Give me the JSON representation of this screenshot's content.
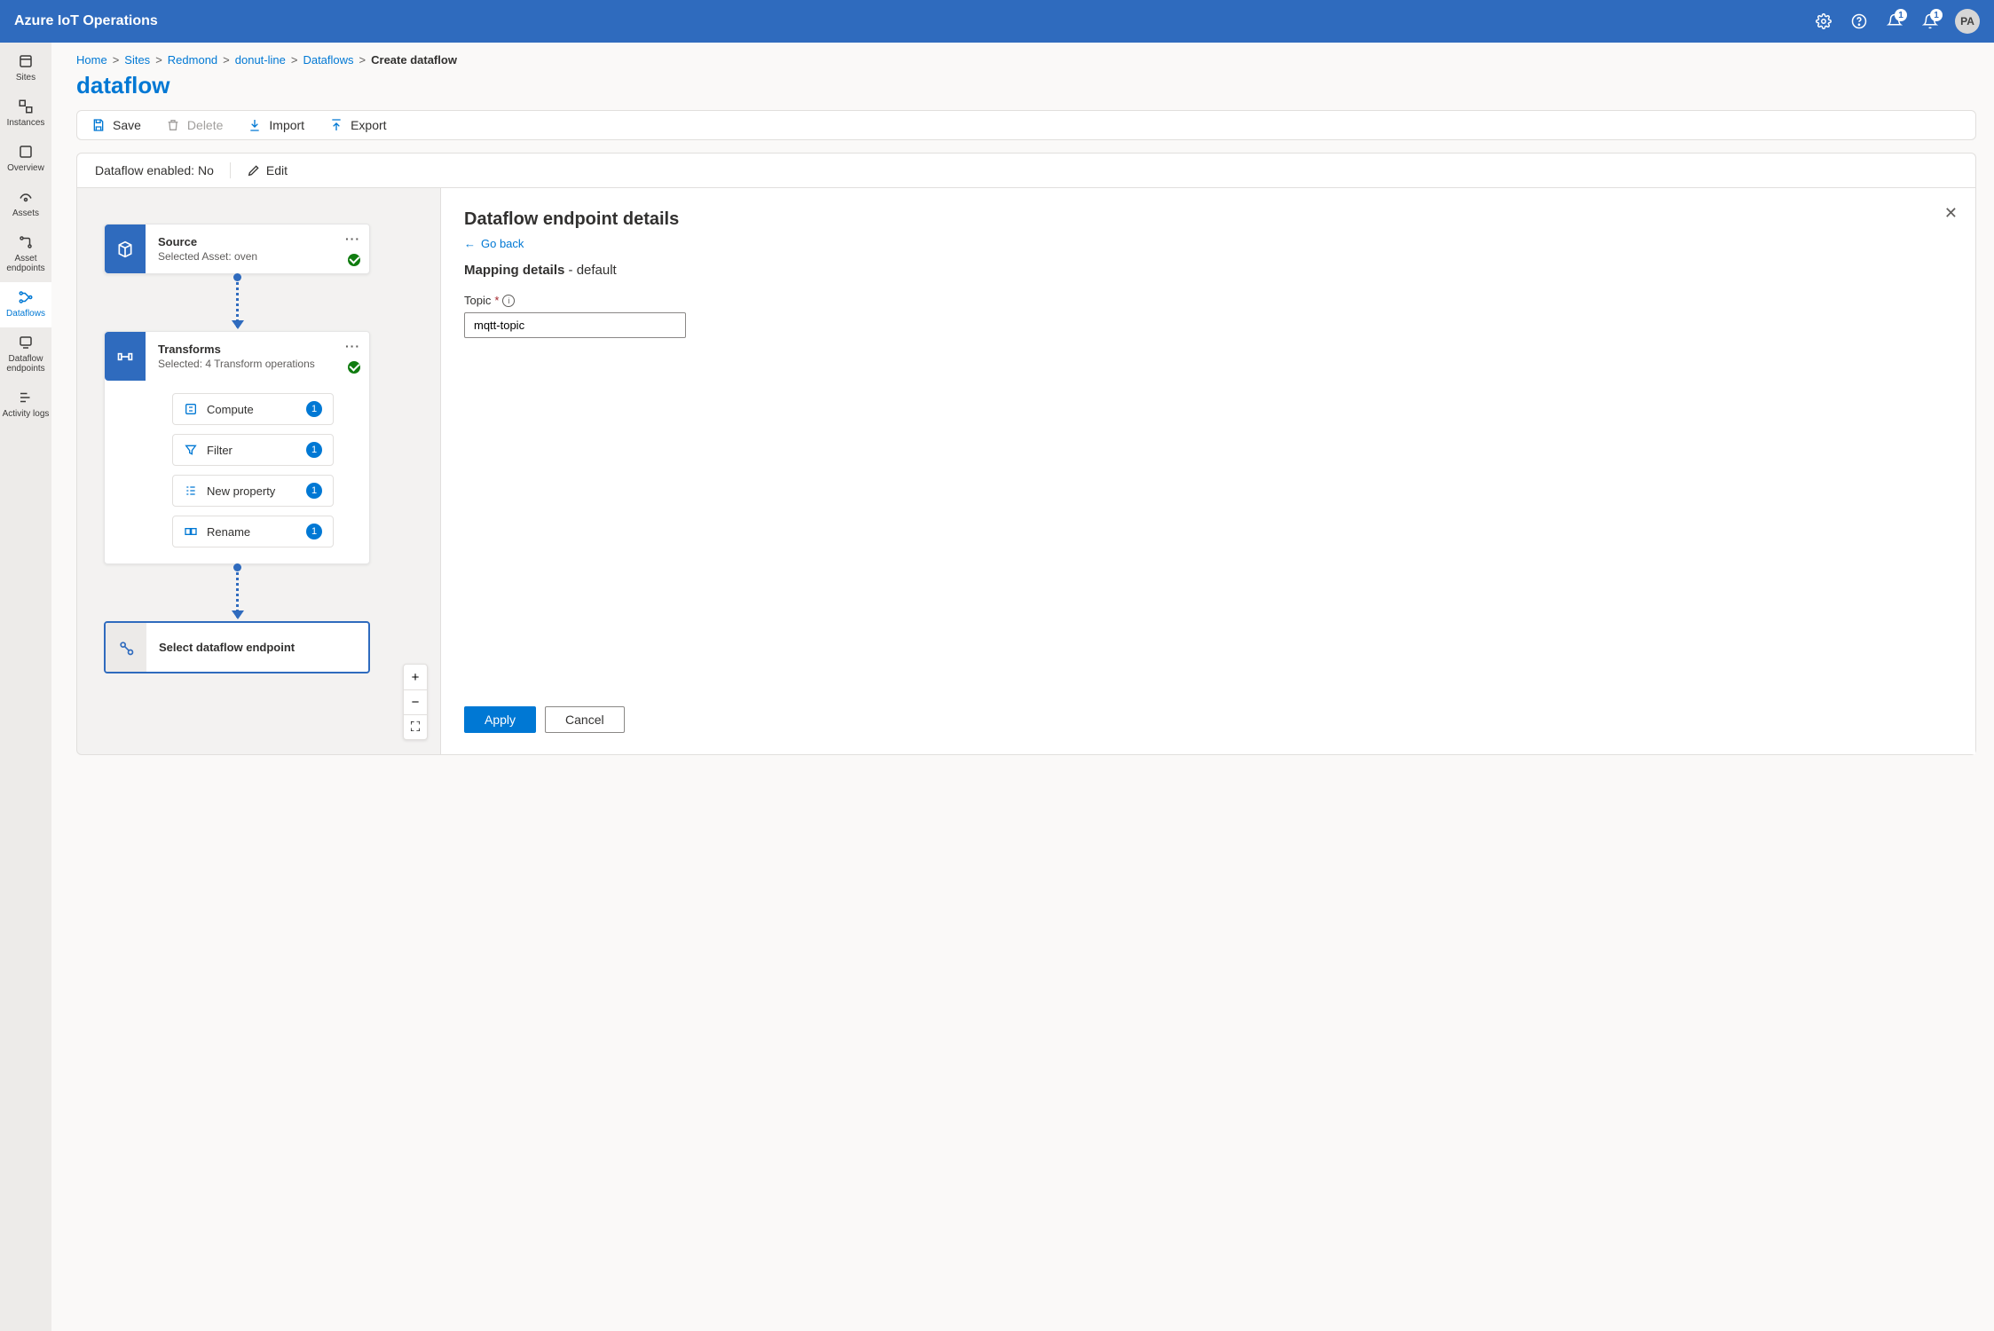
{
  "header": {
    "product": "Azure IoT Operations",
    "notif1": "1",
    "notif2": "1",
    "avatar": "PA"
  },
  "sidebar": {
    "items": [
      {
        "label": "Sites"
      },
      {
        "label": "Instances"
      },
      {
        "label": "Overview"
      },
      {
        "label": "Assets"
      },
      {
        "label": "Asset endpoints"
      },
      {
        "label": "Dataflows"
      },
      {
        "label": "Dataflow endpoints"
      },
      {
        "label": "Activity logs"
      }
    ]
  },
  "breadcrumb": {
    "home": "Home",
    "sites": "Sites",
    "redmond": "Redmond",
    "line": "donut-line",
    "dataflows": "Dataflows",
    "current": "Create dataflow"
  },
  "page": {
    "title": "dataflow"
  },
  "toolbar": {
    "save": "Save",
    "delete": "Delete",
    "import": "Import",
    "export": "Export"
  },
  "status": {
    "text": "Dataflow enabled: No",
    "edit": "Edit"
  },
  "nodes": {
    "source": {
      "title": "Source",
      "sub": "Selected Asset: oven"
    },
    "transforms": {
      "title": "Transforms",
      "sub": "Selected: 4 Transform operations",
      "ops": [
        {
          "name": "Compute",
          "count": "1"
        },
        {
          "name": "Filter",
          "count": "1"
        },
        {
          "name": "New property",
          "count": "1"
        },
        {
          "name": "Rename",
          "count": "1"
        }
      ]
    },
    "endpoint": {
      "label": "Select dataflow endpoint"
    }
  },
  "details": {
    "title": "Dataflow endpoint details",
    "goback": "Go back",
    "mapping_label": "Mapping details",
    "mapping_value": "default",
    "topic_label": "Topic",
    "topic_value": "mqtt-topic",
    "apply": "Apply",
    "cancel": "Cancel"
  },
  "zoom": {
    "in": "+",
    "out": "−",
    "fit": "⛶"
  }
}
